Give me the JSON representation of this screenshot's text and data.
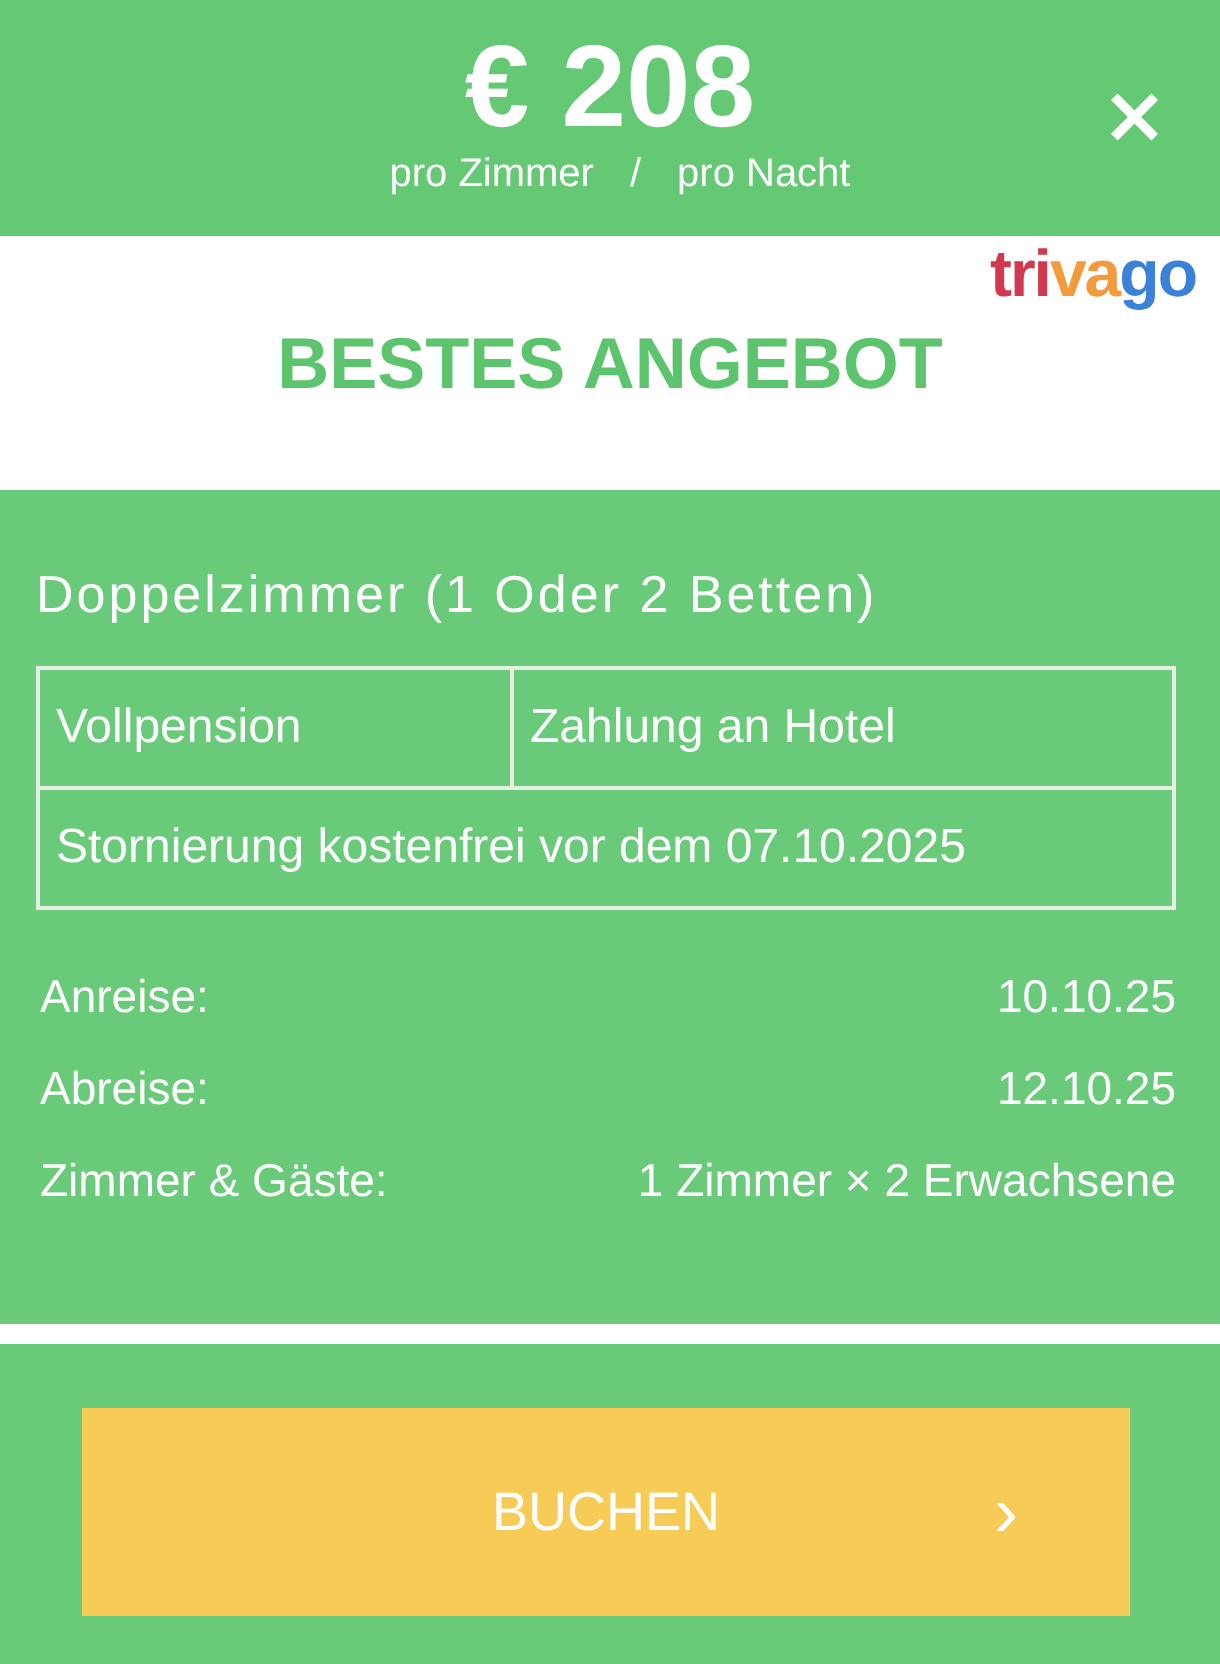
{
  "header": {
    "price": "€ 208",
    "per_room": "pro Zimmer",
    "separator": "/",
    "per_night": "pro Nacht",
    "close": "×"
  },
  "banner": {
    "logo": [
      {
        "text": "tri",
        "color": "#d13a4e"
      },
      {
        "text": "va",
        "color": "#f29a3c"
      },
      {
        "text": "go",
        "color": "#3a82d8"
      }
    ],
    "title": "BESTES ANGEBOT"
  },
  "room": {
    "title": "Doppelzimmer (1 Oder 2 Betten)",
    "board": "Vollpension",
    "payment": "Zahlung an Hotel",
    "cancellation": "Stornierung kostenfrei vor dem 07.10.2025"
  },
  "details": [
    {
      "label": "Anreise:",
      "value": "10.10.25"
    },
    {
      "label": "Abreise:",
      "value": "12.10.25"
    },
    {
      "label": "Zimmer & Gäste:",
      "value": "1 Zimmer × 2 Erwachsene"
    }
  ],
  "button": {
    "label": "BUCHEN",
    "arrow": "›"
  }
}
